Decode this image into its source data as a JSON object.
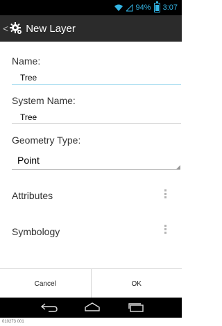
{
  "status": {
    "signal": "⧍",
    "battery_pct": "94%",
    "time": "3:07"
  },
  "actionbar": {
    "back": "<",
    "title": "New Layer"
  },
  "form": {
    "name_label": "Name:",
    "name_value": "Tree",
    "system_name_label": "System Name:",
    "system_name_value": "Tree",
    "geometry_label": "Geometry Type:",
    "geometry_value": "Point"
  },
  "rows": {
    "attributes": "Attributes",
    "symbology": "Symbology"
  },
  "buttons": {
    "cancel": "Cancel",
    "ok": "OK"
  },
  "caption": "010273 001",
  "colors": {
    "accent": "#33b5e5",
    "actionbar": "#2b2b2b"
  }
}
